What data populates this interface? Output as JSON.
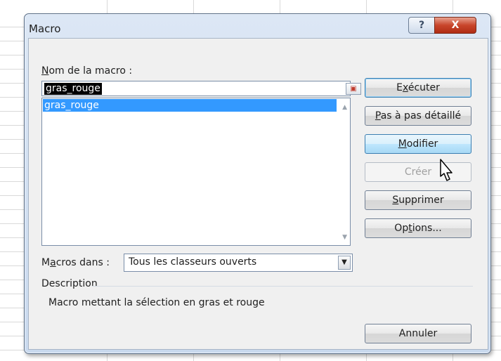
{
  "dialog": {
    "title": "Macro",
    "help_symbol": "?",
    "close_symbol": "X"
  },
  "labels": {
    "macro_name_prefix": "N",
    "macro_name_rest": "om de la macro :",
    "macros_in_prefix": "M",
    "macros_in_u": "a",
    "macros_in_rest": "cros dans :",
    "description": "Description"
  },
  "macro_name_input": {
    "value": "gras_rouge"
  },
  "macro_list": {
    "items": [
      "gras_rouge"
    ],
    "selected": "gras_rouge"
  },
  "macros_in": {
    "value": "Tous les classeurs ouverts"
  },
  "description_text": "Macro mettant la sélection en gras et rouge",
  "buttons": {
    "execute": {
      "pre": "E",
      "u": "x",
      "post": "écuter"
    },
    "step_into": {
      "u": "P",
      "post": "as à pas détaillé"
    },
    "edit": {
      "u": "M",
      "post": "odifier"
    },
    "create": "Créer",
    "delete": {
      "u": "S",
      "post": "upprimer"
    },
    "options": {
      "pre": "Op",
      "u": "t",
      "post": "ions..."
    },
    "cancel": "Annuler"
  },
  "icons": {
    "help": "question-mark-icon",
    "close": "close-icon",
    "ref_picker": "range-picker-icon",
    "dropdown": "chevron-down-icon",
    "cursor": "mouse-pointer-icon"
  },
  "colors": {
    "selection": "#3399ff",
    "close_button": "#c8452b",
    "dialog_frame": "#c9d9ee"
  }
}
